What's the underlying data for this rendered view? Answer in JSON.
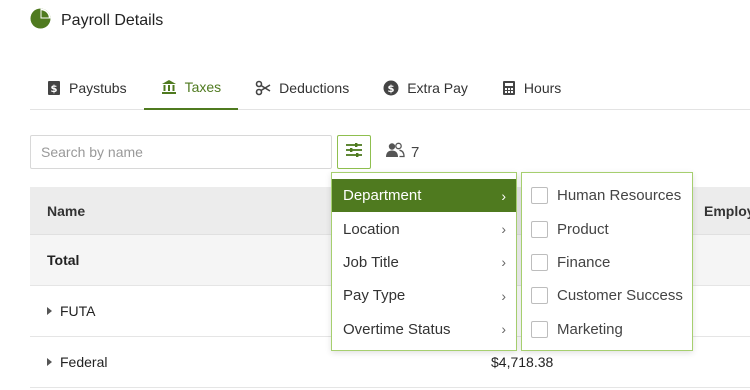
{
  "header": {
    "title": "Payroll Details",
    "icon": "pie-chart-icon"
  },
  "tabs": [
    {
      "label": "Paystubs",
      "icon": "dollar-doc-icon",
      "active": false
    },
    {
      "label": "Taxes",
      "icon": "bank-icon",
      "active": true
    },
    {
      "label": "Deductions",
      "icon": "scissors-icon",
      "active": false
    },
    {
      "label": "Extra Pay",
      "icon": "dollar-circle-icon",
      "active": false
    },
    {
      "label": "Hours",
      "icon": "calculator-icon",
      "active": false
    }
  ],
  "search": {
    "placeholder": "Search by name",
    "value": ""
  },
  "filter": {
    "icon": "sliders-icon"
  },
  "people": {
    "icon": "people-icon",
    "count": "7"
  },
  "table": {
    "columns": [
      "Name",
      "Employ"
    ],
    "rows": [
      {
        "name": "Total",
        "amount": ""
      },
      {
        "name": "FUTA",
        "amount": ""
      },
      {
        "name": "Federal",
        "amount": "$4,718.38"
      }
    ]
  },
  "menu": {
    "items": [
      {
        "label": "Department",
        "active": true
      },
      {
        "label": "Location",
        "active": false
      },
      {
        "label": "Job Title",
        "active": false
      },
      {
        "label": "Pay Type",
        "active": false
      },
      {
        "label": "Overtime Status",
        "active": false
      }
    ]
  },
  "submenu": {
    "items": [
      {
        "label": "Human Resources",
        "checked": false
      },
      {
        "label": "Product",
        "checked": false
      },
      {
        "label": "Finance",
        "checked": false
      },
      {
        "label": "Customer Success",
        "checked": false
      },
      {
        "label": "Marketing",
        "checked": false
      }
    ]
  },
  "colors": {
    "accent": "#4f7a1f",
    "border_accent": "#a6cf6f",
    "header_bg": "#ececec"
  }
}
